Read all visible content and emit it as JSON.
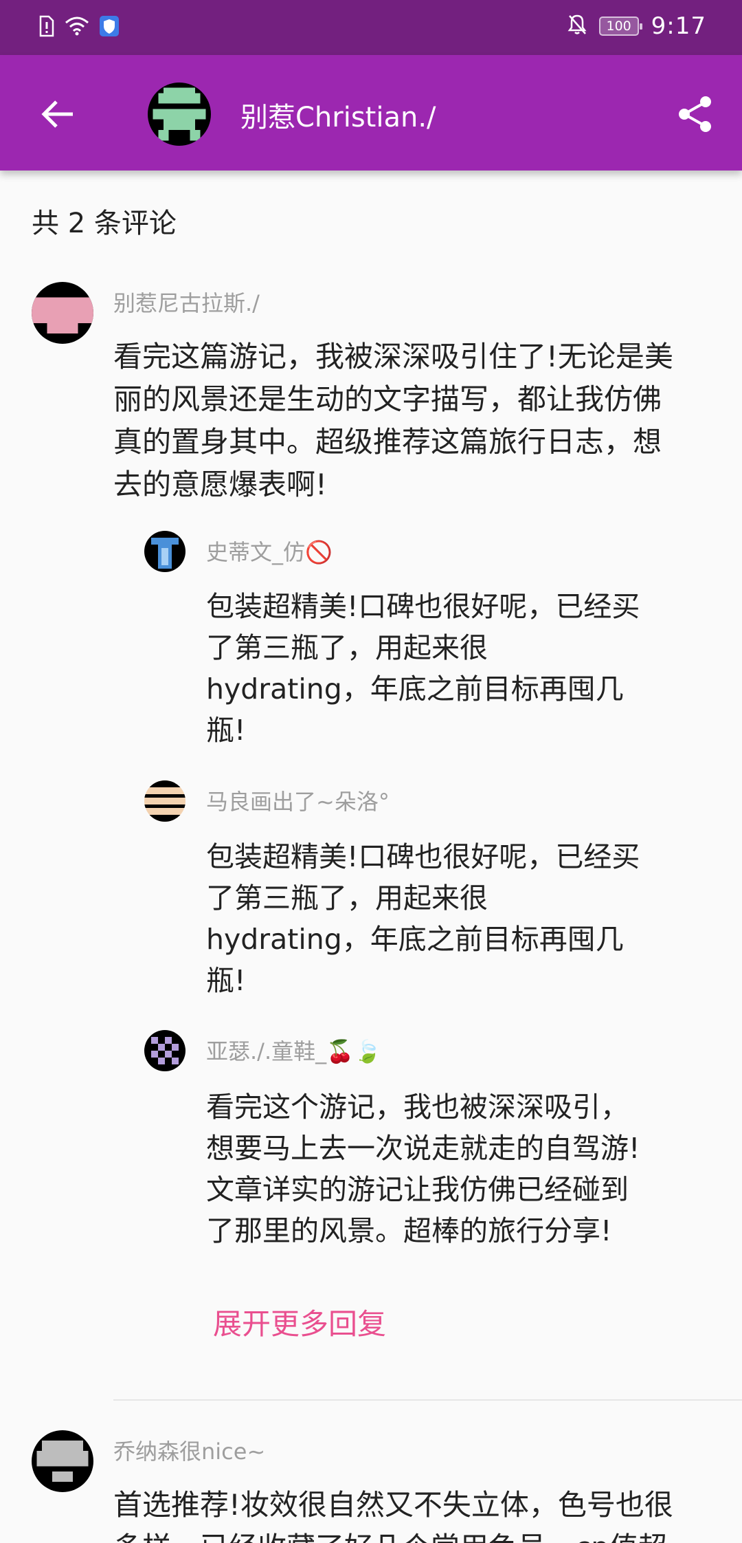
{
  "status_bar": {
    "time": "9:17",
    "battery": "100"
  },
  "app_bar": {
    "title": "别惹Christian./"
  },
  "comments_header": {
    "count_text": "共 2 条评论"
  },
  "comments": [
    {
      "author": "别惹尼古拉斯./",
      "lines": [
        "看完这篇游记，我被深深吸引住了!无论是美",
        "丽的风景还是生动的文字描写，都让我仿佛",
        "真的置身其中。超级推荐这篇旅行日志，想",
        "去的意愿爆表啊!"
      ],
      "replies": [
        {
          "author": "史蒂文_仿🚫",
          "lines": [
            "包装超精美!口碑也很好呢，已经买",
            "了第三瓶了，用起来很",
            "hydrating，年底之前目标再囤几",
            "瓶!"
          ]
        },
        {
          "author": "马良画出了~朵洛°",
          "lines": [
            "包装超精美!口碑也很好呢，已经买",
            "了第三瓶了，用起来很",
            "hydrating，年底之前目标再囤几",
            "瓶!"
          ]
        },
        {
          "author": "亚瑟./.童鞋_🍒🍃",
          "lines": [
            "看完这个游记，我也被深深吸引，",
            "想要马上去一次说走就走的自驾游!",
            "文章详实的游记让我仿佛已经碰到",
            "了那里的风景。超棒的旅行分享!"
          ]
        }
      ],
      "expand_label": "展开更多回复"
    },
    {
      "author": "乔纳森很nice~",
      "lines": [
        "首选推荐!妆效很自然又不失立体，色号也很",
        "多样，已经收藏了好几个常用色号，cp值超"
      ]
    }
  ],
  "icons": {
    "back": "arrow-back-icon",
    "share": "share-icon",
    "status_left": [
      "sim-alert-icon",
      "wifi-icon",
      "shield-icon"
    ],
    "status_right": [
      "notifications-off-icon",
      "battery-icon"
    ]
  },
  "colors": {
    "status_bar": "#73207f",
    "app_bar": "#9c27b0",
    "link": "#e94f8f",
    "name": "#9e9e9e"
  }
}
